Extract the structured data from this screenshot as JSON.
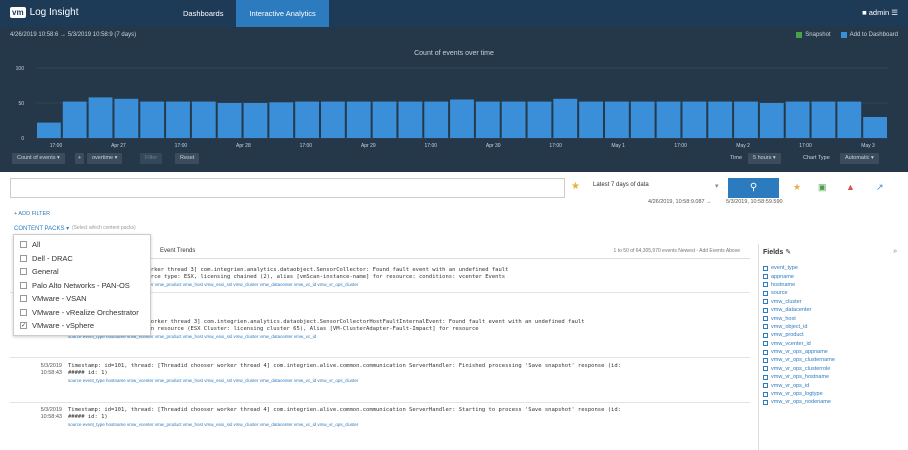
{
  "app": {
    "logo_mark": "vm",
    "title": "Log Insight"
  },
  "nav": {
    "tabs": [
      {
        "label": "Dashboards"
      },
      {
        "label": "Interactive Analytics"
      }
    ],
    "active_tab": "Interactive Analytics"
  },
  "user": {
    "label": "admin"
  },
  "chart_panel": {
    "date_range": "4/26/2019 10:58:6 → 5/3/2019 10:58:9 (7 days)",
    "snapshot_label": "Snapshot",
    "add_label": "Add to Dashboard",
    "group_by_label": "Count of events",
    "fn_label": "overtime",
    "filter_label": "Filter",
    "reset_label": "Reset",
    "time_label": "Time",
    "time_value": "5 hours",
    "chart_type_label": "Chart Type",
    "chart_type_value": "Automatic"
  },
  "chart_data": {
    "type": "bar",
    "title": "Count of events over time",
    "xlabel": "",
    "ylabel": "",
    "ylim": [
      0,
      100
    ],
    "yticks": [
      "100",
      "50",
      "0"
    ],
    "xticks": [
      "17:00",
      "Apr 27",
      "17:00",
      "Apr 28",
      "17:00",
      "Apr 29",
      "17:00",
      "Apr 30",
      "17:00",
      "May 1",
      "17:00",
      "May 2",
      "17:00",
      "May 3"
    ],
    "values": [
      22,
      52,
      58,
      56,
      52,
      52,
      52,
      50,
      50,
      51,
      52,
      52,
      52,
      52,
      52,
      52,
      55,
      52,
      52,
      52,
      56,
      52,
      52,
      52,
      52,
      52,
      52,
      52,
      50,
      52,
      52,
      52,
      30
    ],
    "colors": {
      "bar": "#3b8fd9",
      "background": "#25384a",
      "grid": "#3a4e60",
      "text": "#c9d3dc"
    }
  },
  "search": {
    "query": "",
    "time_range": "Latest 7 days of data",
    "start": "4/26/2019, 10:58:9.087 →",
    "end": "5/3/2019, 10:58:59.590",
    "search_icon": "magnifier-icon"
  },
  "filters": {
    "add_filter_label": "+ ADD FILTER",
    "content_packs_label": "CONTENT PACKS ▾",
    "content_packs_hint": "(Select which content packs)"
  },
  "content_packs": {
    "items": [
      {
        "label": "All",
        "checked": false
      },
      {
        "label": "Dell - DRAC",
        "checked": false
      },
      {
        "label": "General",
        "checked": false
      },
      {
        "label": "Palo Alto Networks - PAN-OS",
        "checked": false
      },
      {
        "label": "VMware - VSAN",
        "checked": false
      },
      {
        "label": "VMware - vRealize Orchestrator",
        "checked": false
      },
      {
        "label": "VMware - vSphere",
        "checked": true
      }
    ]
  },
  "events": {
    "header_title": "Event Trends",
    "header_meta": "1 to 50 of 64,305,970 events   Newest · Add Events Above",
    "rows": [
      {
        "date": "",
        "time": "",
        "lines": [
          "####  [Threadid chooser worker thread 3] com.integrien.analytics.dataobject.SensorCollector: Found fault event with an undefined fault",
          "definition reacted: resource type: ESX, licensing chained (2), alias [vmScan-instance-name] for resource: conditions: vcenter Events"
        ],
        "fields": "source  event_type  hostname  vmw_vcenter  vmw_product  vmw_host  vmw_esxi_ssl  vmw_cluster  vmw_datacenter  vmw_vc_id  vmw_vr_ops_cluster"
      },
      {
        "date": "",
        "time": "",
        "lines": [
          "ERROR [Threadid chooser worker thread 3] com.integrien.analytics.dataobject.SensorCollectorHostFaultInternalEvent: Found fault event with an undefined fault",
          "definition reacted. Fed on resource (ESX Cluster: licensing cluster 65), Alias [VM-ClusterAdapter-Fault-Impact] for resource"
        ],
        "fields": "source  event_type  hostname  vmw_vcenter  vmw_product  vmw_host  vmw_esxi_ssl  vmw_cluster  vmw_datacenter  vmw_vc_id"
      },
      {
        "date": "5/3/2019",
        "time": "10:58:43",
        "lines": [
          "Timestamp: id=101, thread: [Threadid chooser worker thread 4] com.integrien.alive.common.communication ServerHandler: Finished processing 'Save snapshot' response (id:",
          "##### id: 1)"
        ],
        "fields": "source  event_type  hostname  vmw_vcenter  vmw_product  vmw_host  vmw_esxi_ssl  vmw_cluster  vmw_datacenter  vmw_vc_id  vmw_vr_ops_cluster"
      },
      {
        "date": "5/3/2019",
        "time": "10:58:43",
        "lines": [
          "Timestamp: id=101, thread: [Threadid chooser worker thread 4] com.integrien.alive.common.communication ServerHandler: Starting to process 'Save snapshot' response (id:",
          "##### id: 1)"
        ],
        "fields": "source  event_type  hostname  vmw_vcenter  vmw_product  vmw_host  vmw_esxi_ssl  vmw_cluster  vmw_datacenter  vmw_vc_id  vmw_vr_ops_cluster"
      }
    ]
  },
  "fields_panel": {
    "title": "Fields",
    "items": [
      "event_type",
      "appname",
      "hostname",
      "source",
      "vmw_cluster",
      "vmw_datacenter",
      "vmw_host",
      "vmw_object_id",
      "vmw_product",
      "vmw_vcenter_id",
      "vmw_vr_ops_appname",
      "vmw_vr_ops_clustername",
      "vmw_vr_ops_clusterrole",
      "vmw_vr_ops_hostname",
      "vmw_vr_ops_id",
      "vmw_vr_ops_logtype",
      "vmw_vr_ops_nodename"
    ]
  }
}
